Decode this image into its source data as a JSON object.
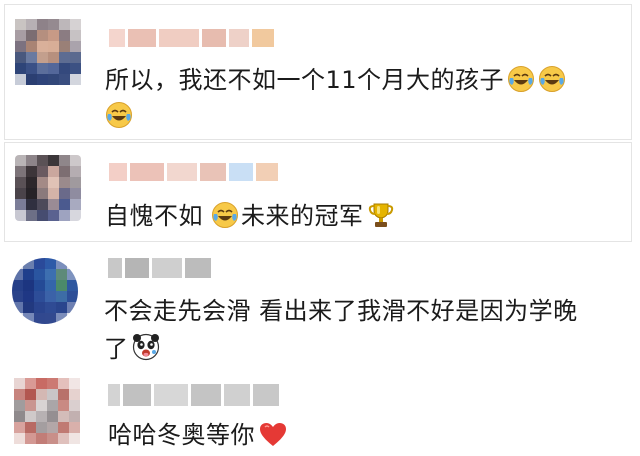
{
  "comments": [
    {
      "text_line1": "所以，我还不如一个11个月大的孩子",
      "emoji": [
        "laugh-cry-icon",
        "laugh-cry-icon",
        "laugh-cry-icon"
      ]
    },
    {
      "text_a": "自愧不如",
      "text_b": "未来的冠军",
      "emoji": [
        "laugh-cry-icon",
        "trophy-icon"
      ]
    },
    {
      "text_line1": "不会走先会滑 看出来了我滑不好是因为学晚",
      "text_line2": "了",
      "emoji": [
        "panda-icon"
      ]
    },
    {
      "text": "哈哈冬奥等你",
      "emoji": [
        "red-heart-icon"
      ]
    }
  ],
  "colors": {
    "heart": "#e53935",
    "trophy": "#d9a400",
    "emoji_face": "#f7c948",
    "tear": "#5aa9e6"
  }
}
